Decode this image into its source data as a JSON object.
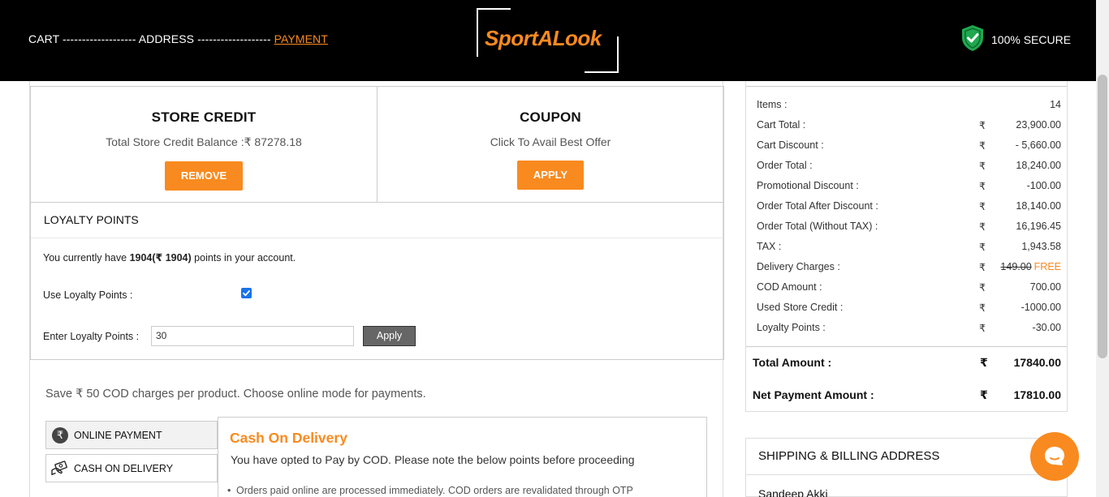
{
  "header": {
    "steps": [
      {
        "label": "CART"
      },
      {
        "label": "ADDRESS"
      },
      {
        "label": "PAYMENT"
      }
    ],
    "dash": "-------------------",
    "logo_text": "SportALook",
    "secure_text": "100% SECURE"
  },
  "store_credit": {
    "title": "STORE CREDIT",
    "subtitle": "Total Store Credit Balance :₹ 87278.18",
    "button": "REMOVE"
  },
  "coupon": {
    "title": "COUPON",
    "subtitle": "Click To Avail Best Offer",
    "button": "APPLY"
  },
  "loyalty": {
    "heading": "LOYALTY POINTS",
    "have_prefix": "You currently have ",
    "have_bold": "1904(₹ 1904)",
    "have_suffix": " points in your account.",
    "use_label": "Use Loyalty Points :",
    "use_checked": true,
    "enter_label": "Enter Loyalty Points :",
    "enter_value": "30",
    "apply_button": "Apply"
  },
  "payment": {
    "save_note": "Save ₹ 50 COD charges per product. Choose online mode for payments.",
    "tabs": [
      {
        "label": "ONLINE PAYMENT",
        "icon": "rupee-icon"
      },
      {
        "label": "CASH ON DELIVERY",
        "icon": "cash-hand-icon"
      }
    ],
    "cod": {
      "title": "Cash On Delivery",
      "desc": "You have opted to Pay by COD. Please note the below points before proceeding",
      "bullet": "Orders paid online are processed immediately. COD orders are revalidated through OTP"
    }
  },
  "summary": {
    "currency": "₹",
    "rows": [
      {
        "label": "Items :",
        "value": "14",
        "no_currency": true
      },
      {
        "label": "Cart Total :",
        "value": "23,900.00"
      },
      {
        "label": "Cart Discount :",
        "value": "- 5,660.00"
      },
      {
        "label": "Order Total :",
        "value": "18,240.00"
      },
      {
        "label": "Promotional Discount :",
        "value": "-100.00"
      },
      {
        "label": "Order Total After Discount :",
        "value": "18,140.00"
      },
      {
        "label": "Order Total (Without TAX) :",
        "value": "16,196.45"
      },
      {
        "label": "TAX :",
        "value": "1,943.58"
      },
      {
        "label": "Delivery Charges :",
        "value": "149.00",
        "free": "FREE"
      },
      {
        "label": "COD Amount :",
        "value": "700.00"
      },
      {
        "label": "Used Store Credit :",
        "value": "-1000.00"
      },
      {
        "label": "Loyalty Points :",
        "value": "-30.00"
      }
    ],
    "total_label": "Total Amount :",
    "total_value": "17840.00",
    "net_label": "Net Payment Amount :",
    "net_value": "17810.00"
  },
  "shipping": {
    "heading": "SHIPPING & BILLING ADDRESS",
    "name": "Sandeep Akki"
  },
  "colors": {
    "accent": "#f98a1f",
    "header_bg": "#000000",
    "secure_green": "#1fa84f"
  }
}
